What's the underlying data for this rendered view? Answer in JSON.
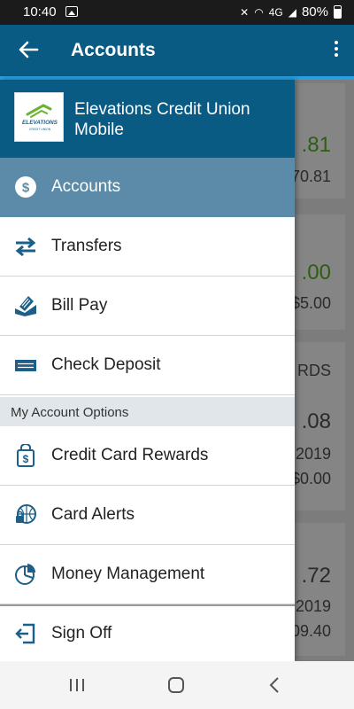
{
  "status": {
    "time": "10:40",
    "battery": "80%",
    "network": "4G"
  },
  "toolbar": {
    "title": "Accounts"
  },
  "drawer": {
    "org_name": "Elevations Credit Union Mobile",
    "logo_text": "ELEVATIONS",
    "logo_subtext": "CREDIT UNION",
    "items": [
      {
        "label": "Accounts",
        "icon": "dollar-circle-icon",
        "active": true
      },
      {
        "label": "Transfers",
        "icon": "transfer-arrows-icon"
      },
      {
        "label": "Bill Pay",
        "icon": "bill-pay-icon"
      },
      {
        "label": "Check Deposit",
        "icon": "check-deposit-icon"
      }
    ],
    "section_header": "My Account Options",
    "options": [
      {
        "label": "Credit Card Rewards",
        "icon": "rewards-bag-icon"
      },
      {
        "label": "Card Alerts",
        "icon": "card-alerts-icon"
      },
      {
        "label": "Money Management",
        "icon": "pie-chart-icon"
      },
      {
        "label": "Sign Off",
        "icon": "sign-off-icon"
      }
    ]
  },
  "background": {
    "v1": ".81",
    "v2": "70.81",
    "v3": ".00",
    "v4": "$5.00",
    "v5": "RDS",
    "v6": ".08",
    "v7": "2019",
    "v8": "$0.00",
    "v9": ".72",
    "v10": "2019",
    "v11": "09.40"
  },
  "colors": {
    "primary": "#0a5b84",
    "accent": "#2a9ee0",
    "active_item": "#5b8ba8",
    "icon": "#1c5f88"
  }
}
